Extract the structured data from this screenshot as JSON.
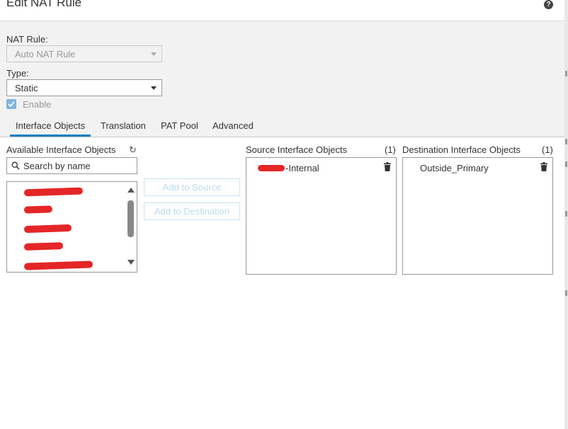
{
  "dialog": {
    "title": "Edit NAT Rule",
    "help_icon": "?"
  },
  "nat_rule": {
    "label": "NAT Rule:",
    "value": "Auto NAT Rule"
  },
  "type": {
    "label": "Type:",
    "value": "Static"
  },
  "enable": {
    "label": "Enable",
    "checked": true
  },
  "tabs": [
    {
      "label": "Interface Objects",
      "active": true
    },
    {
      "label": "Translation",
      "active": false
    },
    {
      "label": "PAT Pool",
      "active": false
    },
    {
      "label": "Advanced",
      "active": false
    }
  ],
  "available": {
    "label": "Available Interface Objects",
    "refresh_icon": "↻",
    "search_placeholder": "Search by name"
  },
  "buttons": {
    "add_to_source": "Add to Source",
    "add_to_destination": "Add to Destination"
  },
  "source": {
    "label": "Source Interface Objects",
    "count": "(1)",
    "items": [
      "-Internal"
    ]
  },
  "destination": {
    "label": "Destination Interface Objects",
    "count": "(1)",
    "items": [
      "Outside_Primary"
    ]
  },
  "colors": {
    "accent": "#0d7fc0",
    "checkbox": "#7eb6db",
    "redaction": "#e42626"
  }
}
